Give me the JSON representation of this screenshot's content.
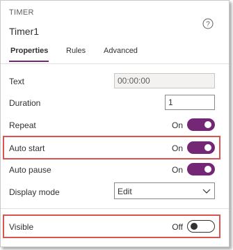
{
  "header": {
    "section_label": "TIMER",
    "control_name": "Timer1"
  },
  "tabs": [
    {
      "label": "Properties",
      "active": true
    },
    {
      "label": "Rules",
      "active": false
    },
    {
      "label": "Advanced",
      "active": false
    }
  ],
  "properties": {
    "text": {
      "label": "Text",
      "value": "00:00:00"
    },
    "duration": {
      "label": "Duration",
      "value": "1"
    },
    "repeat": {
      "label": "Repeat",
      "state_label": "On",
      "on": true
    },
    "auto_start": {
      "label": "Auto start",
      "state_label": "On",
      "on": true
    },
    "auto_pause": {
      "label": "Auto pause",
      "state_label": "On",
      "on": true
    },
    "display_mode": {
      "label": "Display mode",
      "value": "Edit"
    },
    "visible": {
      "label": "Visible",
      "state_label": "Off",
      "on": false
    }
  },
  "icons": {
    "help": "help-icon",
    "dropdown": "chevron-down-icon"
  },
  "colors": {
    "accent": "#742774",
    "highlight": "#d9534f"
  }
}
